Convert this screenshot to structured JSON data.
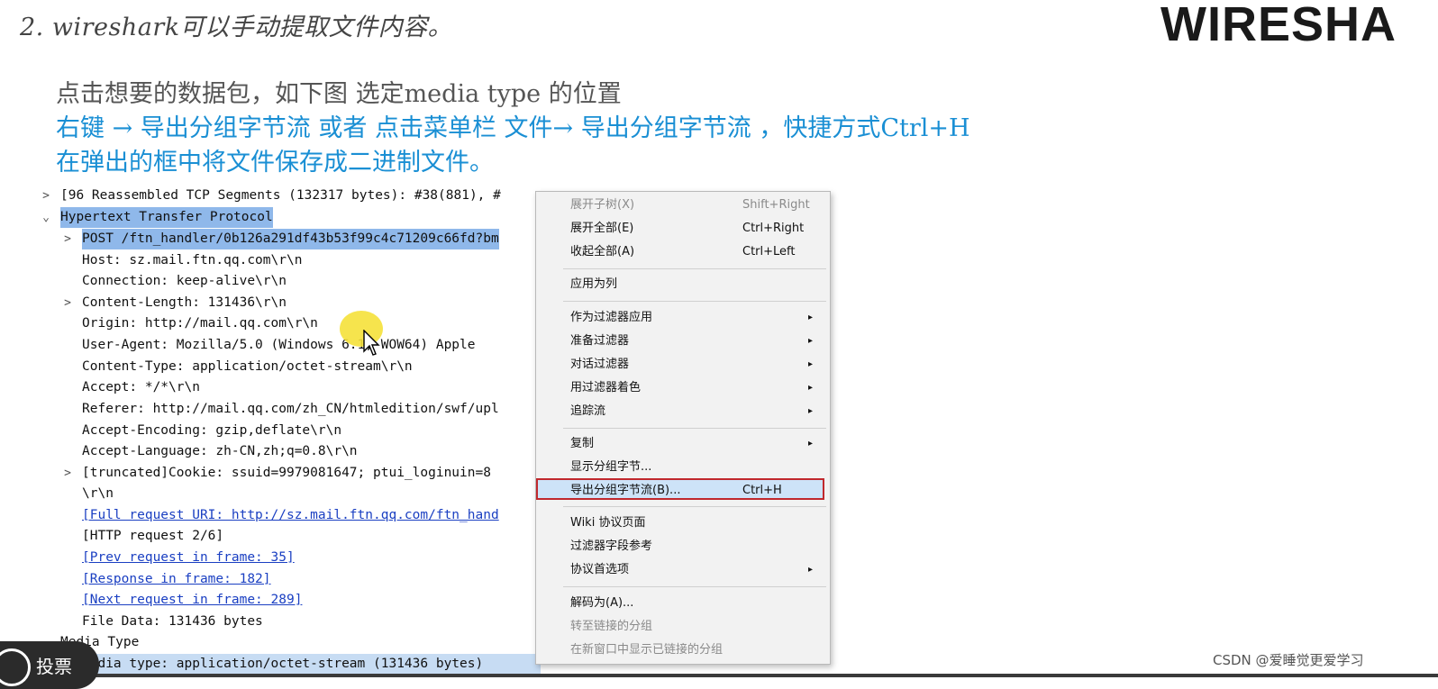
{
  "slide": {
    "title": "2. wireshark可以手动提取文件内容。",
    "logo": [
      "WIRES",
      "HA"
    ],
    "lines": [
      "点击想要的数据包，如下图 选定media type 的位置",
      "右键 → 导出分组字节流   或者 点击菜单栏 文件→ 导出分组字节流 ，快捷方式Ctrl+H",
      "在弹出的框中将文件保存成二进制文件。"
    ]
  },
  "tree": {
    "rows": [
      {
        "text": "[96 Reassembled TCP Segments (132317 bytes): #38(881), #",
        "arrow": ">"
      },
      {
        "text": "Hypertext Transfer Protocol",
        "arrow": "v"
      },
      {
        "text": "POST /ftn_handler/0b126a291df43b53f99c4c71209c66fd?bm",
        "arrow": ">"
      },
      {
        "text": "Host: sz.mail.ftn.qq.com\\r\\n",
        "arrow": ""
      },
      {
        "text": "Connection: keep-alive\\r\\n",
        "arrow": ""
      },
      {
        "text": "Content-Length: 131436\\r\\n",
        "arrow": ">"
      },
      {
        "text": "Origin: http://mail.qq.com\\r\\n",
        "arrow": ""
      },
      {
        "text": "User-Agent: Mozilla/5.0 (Windows    6.1; WOW64) Apple",
        "arrow": ""
      },
      {
        "text": "Content-Type: application/octet-stream\\r\\n",
        "arrow": ""
      },
      {
        "text": "Accept: */*\\r\\n",
        "arrow": ""
      },
      {
        "text": "Referer: http://mail.qq.com/zh_CN/htmledition/swf/upl",
        "arrow": ""
      },
      {
        "text": "Accept-Encoding: gzip,deflate\\r\\n",
        "arrow": ""
      },
      {
        "text": "Accept-Language: zh-CN,zh;q=0.8\\r\\n",
        "arrow": ""
      },
      {
        "text": " [truncated]Cookie: ssuid=9979081647; ptui_loginuin=8",
        "arrow": ">"
      },
      {
        "text": "\\r\\n",
        "arrow": ""
      },
      {
        "text": "[Full request URI: http://sz.mail.ftn.qq.com/ftn_hand",
        "arrow": ""
      },
      {
        "text": "[HTTP request 2/6]",
        "arrow": ""
      },
      {
        "text": "[Prev request in frame: 35]",
        "arrow": ""
      },
      {
        "text": "[Response in frame: 182]",
        "arrow": ""
      },
      {
        "text": "[Next request in frame: 289]",
        "arrow": ""
      },
      {
        "text": "File Data: 131436 bytes",
        "arrow": ""
      },
      {
        "text": "Media Type",
        "arrow": "v"
      },
      {
        "text": "Media type: application/octet-stream (131436 bytes)",
        "arrow": ""
      }
    ]
  },
  "menu": {
    "items": [
      {
        "label": "展开子树(X)",
        "shortcut": "Shift+Right",
        "disabled": true
      },
      {
        "label": "展开全部(E)",
        "shortcut": "Ctrl+Right"
      },
      {
        "label": "收起全部(A)",
        "shortcut": "Ctrl+Left"
      },
      {
        "label": "应用为列"
      },
      {
        "label": "作为过滤器应用",
        "submenu": "▸"
      },
      {
        "label": "准备过滤器",
        "submenu": "▸"
      },
      {
        "label": "对话过滤器",
        "submenu": "▸"
      },
      {
        "label": "用过滤器着色",
        "submenu": "▸"
      },
      {
        "label": "追踪流",
        "submenu": "▸"
      },
      {
        "label": "复制",
        "submenu": "▸"
      },
      {
        "label": "显示分组字节..."
      },
      {
        "label": "导出分组字节流(B)...",
        "shortcut": "Ctrl+H",
        "highlighted": true
      },
      {
        "label": "Wiki 协议页面"
      },
      {
        "label": "过滤器字段参考"
      },
      {
        "label": "协议首选项",
        "submenu": "▸"
      },
      {
        "label": "解码为(A)..."
      },
      {
        "label": "转至链接的分组",
        "disabled": true
      },
      {
        "label": "在新窗口中显示已链接的分组",
        "disabled": true
      }
    ]
  },
  "overlay": {
    "vote_label": "投票",
    "watermark": "CSDN @爱睡觉更爱学习"
  }
}
